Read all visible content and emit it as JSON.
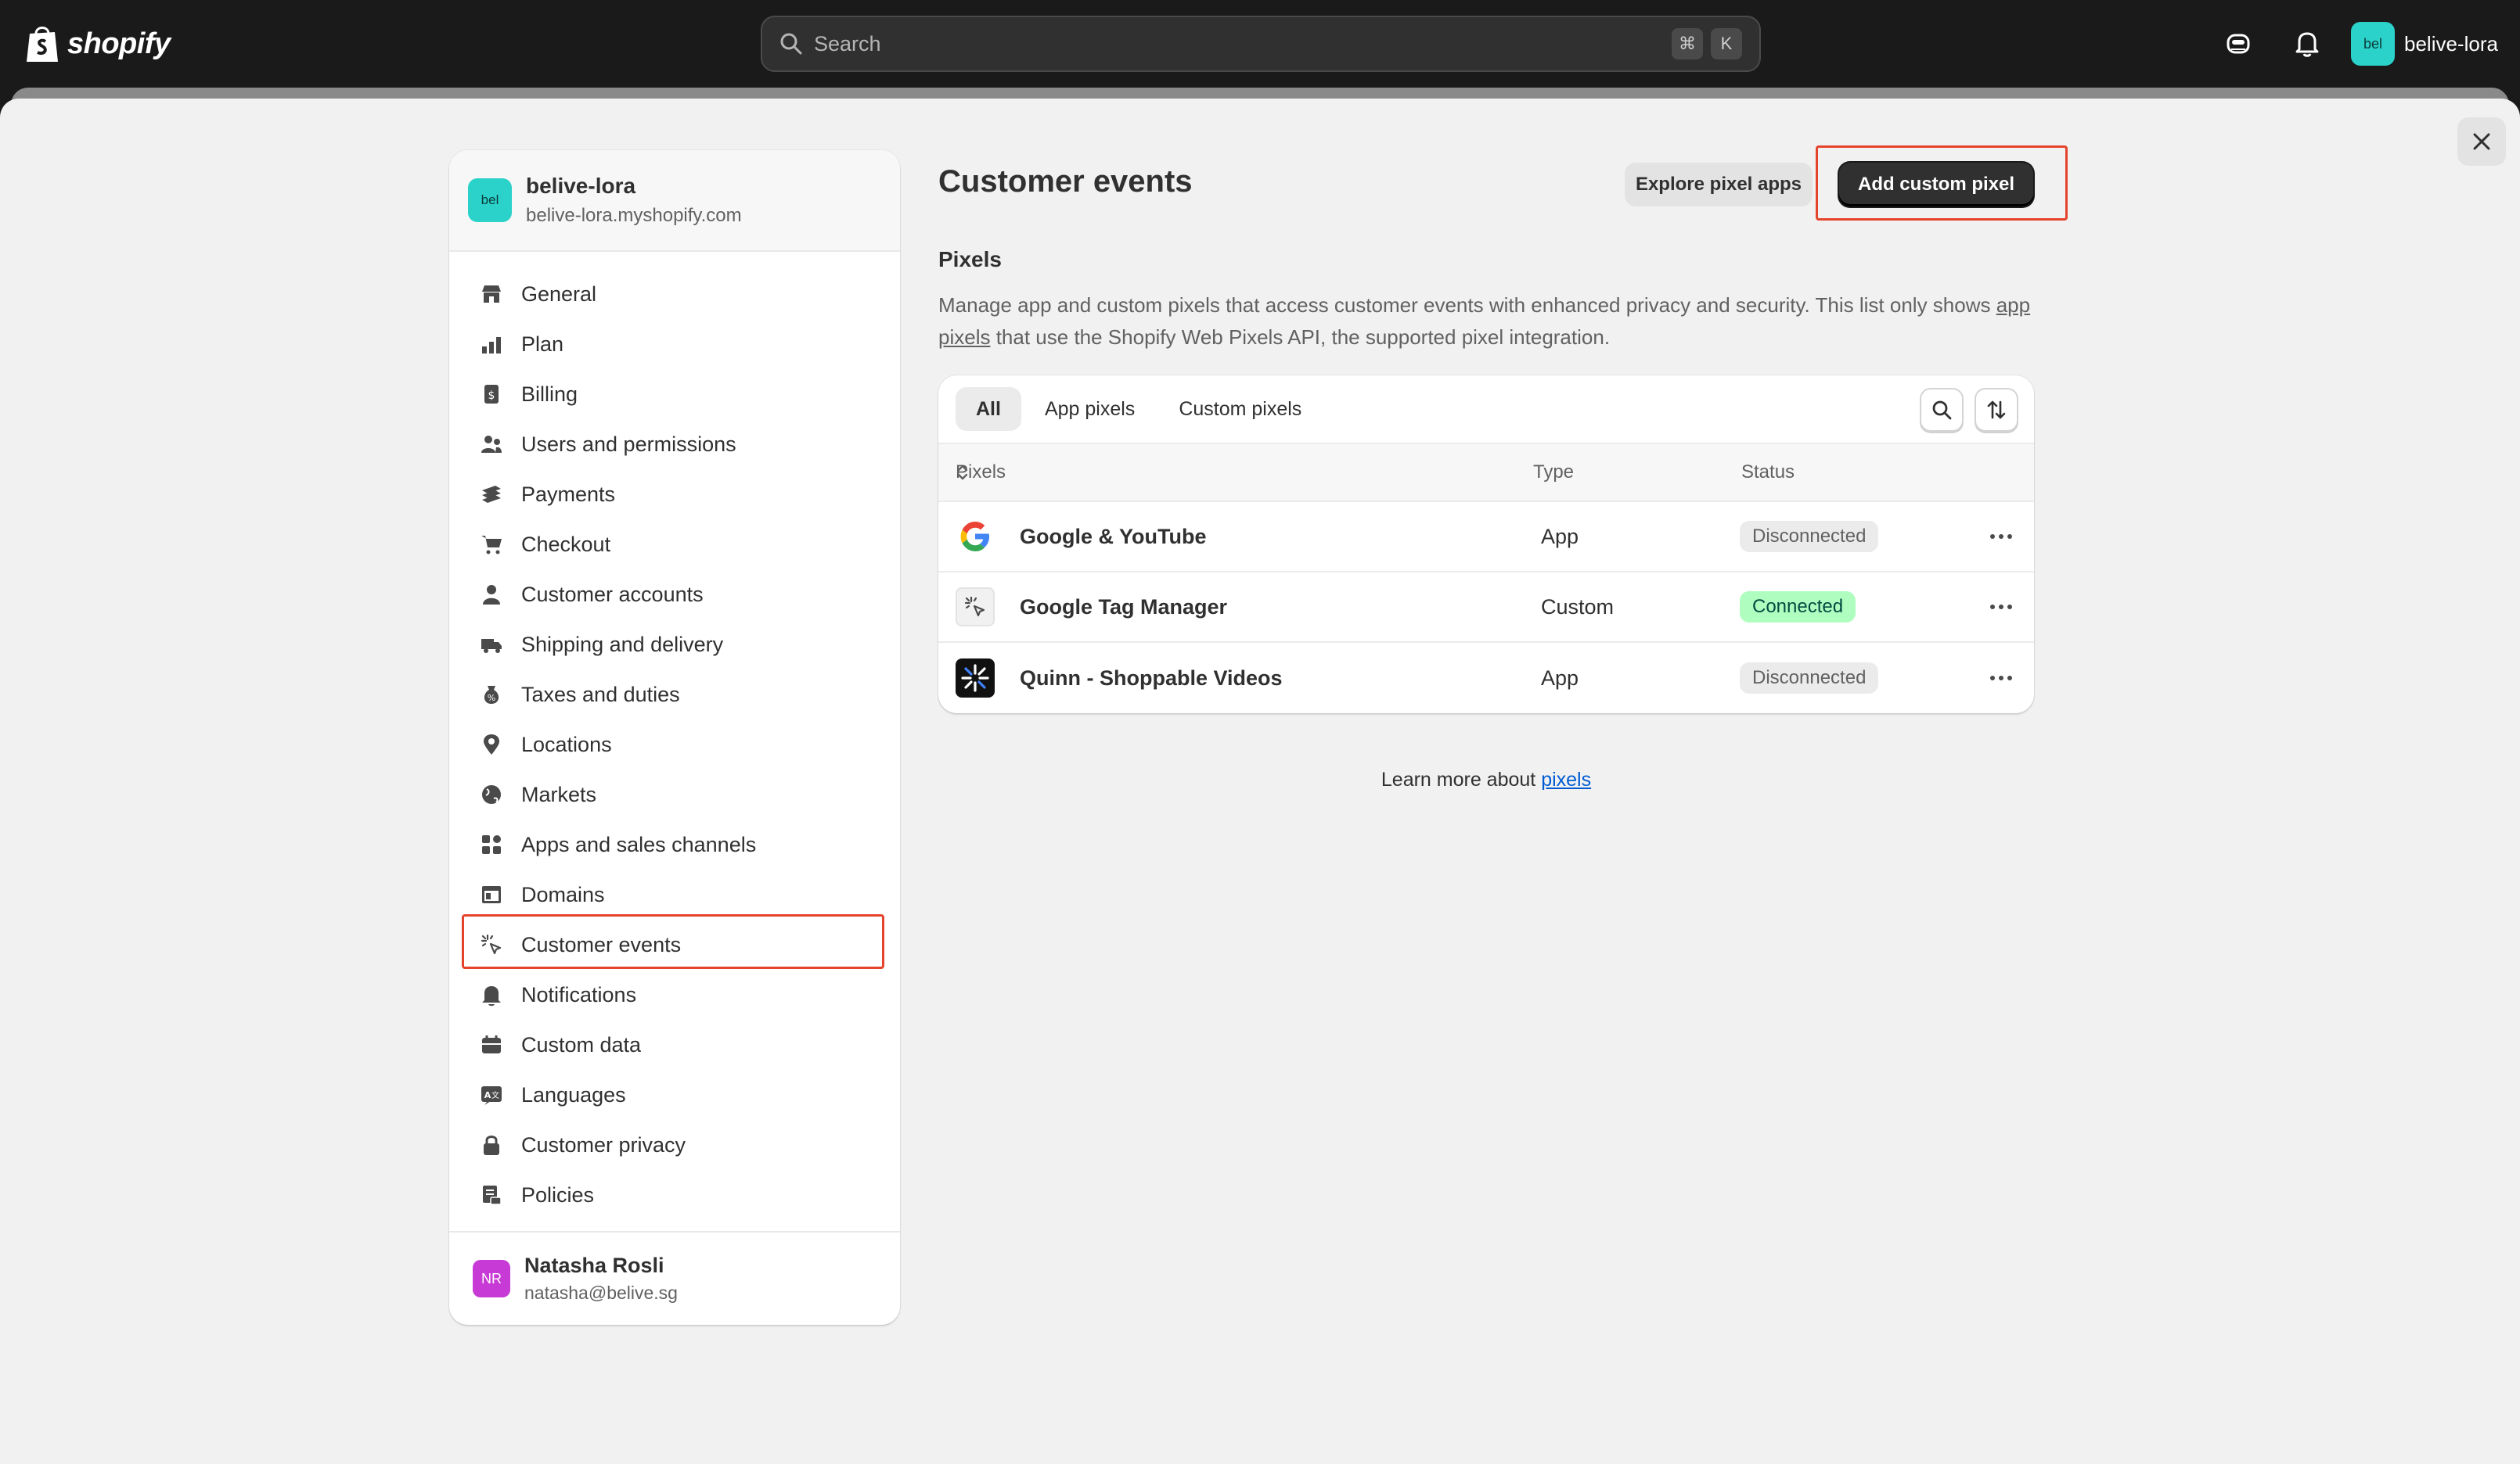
{
  "topbar": {
    "brand": "shopify",
    "search_placeholder": "Search",
    "shortcut_key1": "⌘",
    "shortcut_key2": "K",
    "store_initials": "bel",
    "store_name": "belive-lora"
  },
  "nav": {
    "store_initials": "bel",
    "store_name": "belive-lora",
    "store_domain": "belive-lora.myshopify.com",
    "items": [
      {
        "label": "General",
        "icon": "store-icon"
      },
      {
        "label": "Plan",
        "icon": "plan-icon"
      },
      {
        "label": "Billing",
        "icon": "billing-icon"
      },
      {
        "label": "Users and permissions",
        "icon": "users-icon"
      },
      {
        "label": "Payments",
        "icon": "payments-icon"
      },
      {
        "label": "Checkout",
        "icon": "cart-icon"
      },
      {
        "label": "Customer accounts",
        "icon": "person-icon"
      },
      {
        "label": "Shipping and delivery",
        "icon": "truck-icon"
      },
      {
        "label": "Taxes and duties",
        "icon": "tax-icon"
      },
      {
        "label": "Locations",
        "icon": "location-icon"
      },
      {
        "label": "Markets",
        "icon": "globe-icon"
      },
      {
        "label": "Apps and sales channels",
        "icon": "apps-icon"
      },
      {
        "label": "Domains",
        "icon": "domains-icon"
      },
      {
        "label": "Customer events",
        "icon": "cursor-sparkle-icon"
      },
      {
        "label": "Notifications",
        "icon": "bell-icon"
      },
      {
        "label": "Custom data",
        "icon": "database-icon"
      },
      {
        "label": "Languages",
        "icon": "language-icon"
      },
      {
        "label": "Customer privacy",
        "icon": "lock-icon"
      },
      {
        "label": "Policies",
        "icon": "policies-icon"
      }
    ],
    "active_index": 13,
    "user_initials": "NR",
    "user_name": "Natasha Rosli",
    "user_email": "natasha@belive.sg"
  },
  "main": {
    "title": "Customer events",
    "explore_label": "Explore pixel apps",
    "add_label": "Add custom pixel",
    "section_title": "Pixels",
    "desc_part1": "Manage app and custom pixels that access customer events with enhanced privacy and security. This list only shows ",
    "desc_link": "app pixels",
    "desc_part2": " that use the Shopify Web Pixels API, the supported pixel integration.",
    "tabs": [
      "All",
      "App pixels",
      "Custom pixels"
    ],
    "columns": {
      "pixels": "Pixels",
      "type": "Type",
      "status": "Status"
    },
    "rows": [
      {
        "name": "Google & YouTube",
        "type": "App",
        "status": "Disconnected",
        "icon": "google-icon"
      },
      {
        "name": "Google Tag Manager",
        "type": "Custom",
        "status": "Connected",
        "icon": "cursor-sparkle-icon"
      },
      {
        "name": "Quinn - Shoppable Videos",
        "type": "App",
        "status": "Disconnected",
        "icon": "quinn-logo-icon"
      }
    ],
    "learn_prefix": "Learn more about ",
    "learn_link": "pixels"
  },
  "colors": {
    "topbar_bg": "#1a1a1a",
    "page_bg": "#f1f1f1",
    "primary_button": "#303030",
    "connected_badge": "#affebf",
    "highlight_outline": "#e5432c",
    "link": "#005bd3",
    "store_avatar": "#2ad2c9",
    "user_avatar": "#c73ad5"
  }
}
